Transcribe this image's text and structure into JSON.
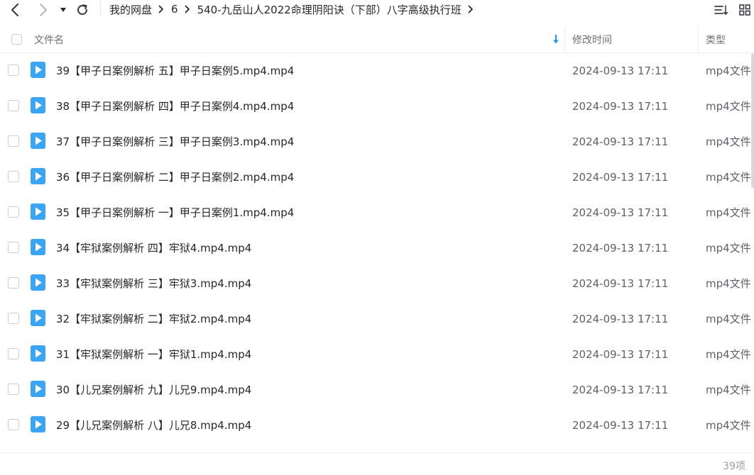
{
  "nav": {
    "back_icon": "chevron-left-icon",
    "forward_icon": "chevron-right-icon",
    "dropdown_icon": "caret-down-icon",
    "refresh_icon": "refresh-icon"
  },
  "breadcrumb": {
    "items": [
      {
        "label": "我的网盘"
      },
      {
        "label": "6"
      },
      {
        "label": "540-九岳山人2022命理阴阳诀（下部）八字高级执行班"
      }
    ]
  },
  "toolbar": {
    "sort_icon": "sort-list-icon",
    "view_icon": "grid-view-icon"
  },
  "table": {
    "headers": {
      "name": "文件名",
      "modified": "修改时间",
      "type": "类型"
    },
    "rows": [
      {
        "name": "39【甲子日案例解析 五】甲子日案例5.mp4.mp4",
        "modified": "2024-09-13 17:11",
        "type": "mp4文件"
      },
      {
        "name": "38【甲子日案例解析 四】甲子日案例4.mp4.mp4",
        "modified": "2024-09-13 17:11",
        "type": "mp4文件"
      },
      {
        "name": "37【甲子日案例解析 三】甲子日案例3.mp4.mp4",
        "modified": "2024-09-13 17:11",
        "type": "mp4文件"
      },
      {
        "name": "36【甲子日案例解析 二】甲子日案例2.mp4.mp4",
        "modified": "2024-09-13 17:11",
        "type": "mp4文件"
      },
      {
        "name": "35【甲子日案例解析 一】甲子日案例1.mp4.mp4",
        "modified": "2024-09-13 17:11",
        "type": "mp4文件"
      },
      {
        "name": "34【牢狱案例解析 四】牢狱4.mp4.mp4",
        "modified": "2024-09-13 17:11",
        "type": "mp4文件"
      },
      {
        "name": "33【牢狱案例解析 三】牢狱3.mp4.mp4",
        "modified": "2024-09-13 17:11",
        "type": "mp4文件"
      },
      {
        "name": "32【牢狱案例解析 二】牢狱2.mp4.mp4",
        "modified": "2024-09-13 17:11",
        "type": "mp4文件"
      },
      {
        "name": "31【牢狱案例解析 一】牢狱1.mp4.mp4",
        "modified": "2024-09-13 17:11",
        "type": "mp4文件"
      },
      {
        "name": "30【儿兄案例解析 九】儿兄9.mp4.mp4",
        "modified": "2024-09-13 17:11",
        "type": "mp4文件"
      },
      {
        "name": "29【儿兄案例解析 八】儿兄8.mp4.mp4",
        "modified": "2024-09-13 17:11",
        "type": "mp4文件"
      },
      {
        "name": "",
        "modified": "",
        "type": ""
      }
    ]
  },
  "footer": {
    "count": "39项"
  },
  "colors": {
    "accent": "#1e9bf0",
    "icon_blue": "#3aa5f5",
    "text": "#25272b",
    "muted": "#5d6168",
    "border": "#eceef1"
  }
}
